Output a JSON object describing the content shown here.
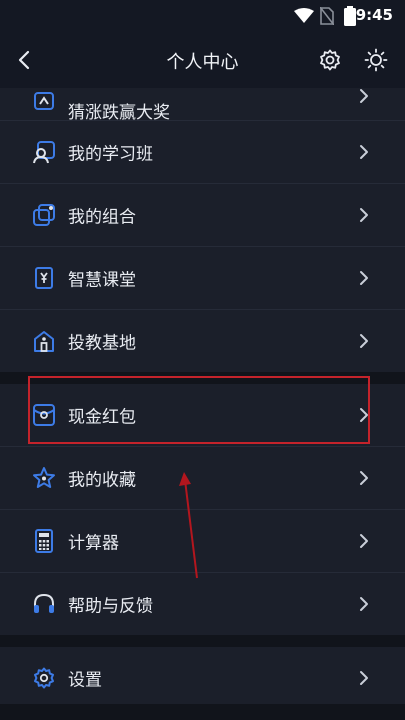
{
  "status_bar": {
    "time": "9:45"
  },
  "header": {
    "title": "个人中心",
    "back_icon": "back-arrow-icon",
    "settings_icon": "gear-icon",
    "theme_icon": "sun-icon"
  },
  "groups": [
    {
      "items": [
        {
          "label": "猜涨跌赢大奖",
          "icon": "trend-badge-icon"
        },
        {
          "label": "我的学习班",
          "icon": "study-class-icon"
        },
        {
          "label": "我的组合",
          "icon": "portfolio-icon"
        },
        {
          "label": "智慧课堂",
          "icon": "smart-classroom-icon"
        },
        {
          "label": "投教基地",
          "icon": "education-base-icon"
        }
      ]
    },
    {
      "items": [
        {
          "label": "现金红包",
          "icon": "cash-red-packet-icon"
        },
        {
          "label": "我的收藏",
          "icon": "star-icon"
        },
        {
          "label": "计算器",
          "icon": "calculator-icon"
        },
        {
          "label": "帮助与反馈",
          "icon": "headset-icon"
        }
      ]
    },
    {
      "items": [
        {
          "label": "设置",
          "icon": "gear-icon"
        }
      ]
    }
  ],
  "colors": {
    "accent_icon": "#3d7be6",
    "highlight_box": "#c4232b",
    "background": "#0e1117",
    "row_background": "#1b1f2a"
  }
}
